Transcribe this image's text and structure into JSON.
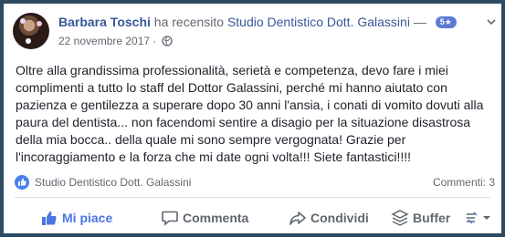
{
  "post": {
    "author": "Barbara Toschi",
    "verb": "ha recensito",
    "page": "Studio Dentistico Dott. Galassini",
    "dash": "—",
    "rating_badge": "5★",
    "date": "22 novembre 2017",
    "separator": "·",
    "body": "Oltre alla grandissima professionalità, serietà e competenza, devo fare i miei complimenti a tutto lo staff del Dottor Galassini, perché mi hanno aiutato con pazienza e gentilezza a superare dopo 30 anni l'ansia, i conati di vomito dovuti alla paura del dentista... non facendomi sentire a disagio per la situazione disastrosa della mia bocca.. della quale mi sono sempre vergognata! Grazie per l'incoraggiamento e la forza che mi date ogni volta!!! Siete fantastici!!!!"
  },
  "reactions": {
    "page_name": "Studio Dentistico Dott. Galassini",
    "comments": "Commenti: 3"
  },
  "actions": {
    "like": "Mi piace",
    "comment": "Commenta",
    "share": "Condividi",
    "buffer": "Buffer"
  },
  "colors": {
    "link": "#385898",
    "like_active": "#4c75e0",
    "badge": "#5b7bd5",
    "frame": "#2d4a63"
  },
  "icons": {
    "header": [
      "globe-icon",
      "caret-down-icon"
    ],
    "meta": [
      "like-reaction-icon"
    ],
    "actions": [
      "thumbs-up-icon",
      "comment-icon",
      "share-icon",
      "buffer-icon",
      "more-icon"
    ]
  }
}
